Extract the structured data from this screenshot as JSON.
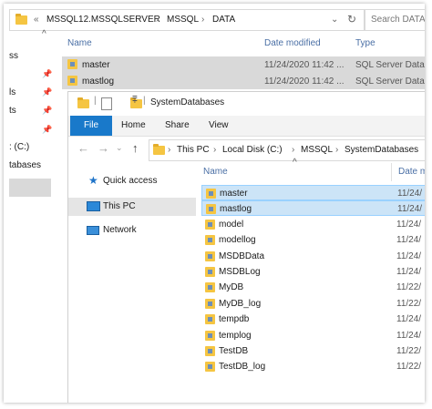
{
  "back_window": {
    "breadcrumb": [
      "«",
      "MSSQL12.MSSQLSERVER",
      "MSSQL",
      "DATA"
    ],
    "search_placeholder": "Search DATA",
    "columns": {
      "name": "Name",
      "date": "Date modified",
      "type": "Type"
    },
    "left_fragments": [
      "ss",
      "ls",
      "ts",
      ": (C:)",
      "tabases"
    ],
    "rows": [
      {
        "name": "master",
        "date": "11/24/2020 11:42 ...",
        "type": "SQL Server Datab"
      },
      {
        "name": "mastlog",
        "date": "11/24/2020 11:42 ...",
        "type": "SQL Server Datab"
      }
    ]
  },
  "front_window": {
    "title": "SystemDatabases",
    "ribbon_tabs": [
      "File",
      "Home",
      "Share",
      "View"
    ],
    "breadcrumb": [
      "This PC",
      "Local Disk (C:)",
      "MSSQL",
      "SystemDatabases"
    ],
    "columns": {
      "name": "Name",
      "date": "Date m"
    },
    "nav": [
      {
        "label": "Quick access",
        "icon": "star-icon"
      },
      {
        "label": "This PC",
        "icon": "computer-icon"
      },
      {
        "label": "Network",
        "icon": "network-icon"
      }
    ],
    "files": [
      {
        "name": "master",
        "date": "11/24/",
        "selected": true
      },
      {
        "name": "mastlog",
        "date": "11/24/",
        "selected": true
      },
      {
        "name": "model",
        "date": "11/24/",
        "selected": false
      },
      {
        "name": "modellog",
        "date": "11/24/",
        "selected": false
      },
      {
        "name": "MSDBData",
        "date": "11/24/",
        "selected": false
      },
      {
        "name": "MSDBLog",
        "date": "11/24/",
        "selected": false
      },
      {
        "name": "MyDB",
        "date": "11/22/",
        "selected": false
      },
      {
        "name": "MyDB_log",
        "date": "11/22/",
        "selected": false
      },
      {
        "name": "tempdb",
        "date": "11/24/",
        "selected": false
      },
      {
        "name": "templog",
        "date": "11/24/",
        "selected": false
      },
      {
        "name": "TestDB",
        "date": "11/22/",
        "selected": false
      },
      {
        "name": "TestDB_log",
        "date": "11/22/",
        "selected": false
      }
    ]
  }
}
